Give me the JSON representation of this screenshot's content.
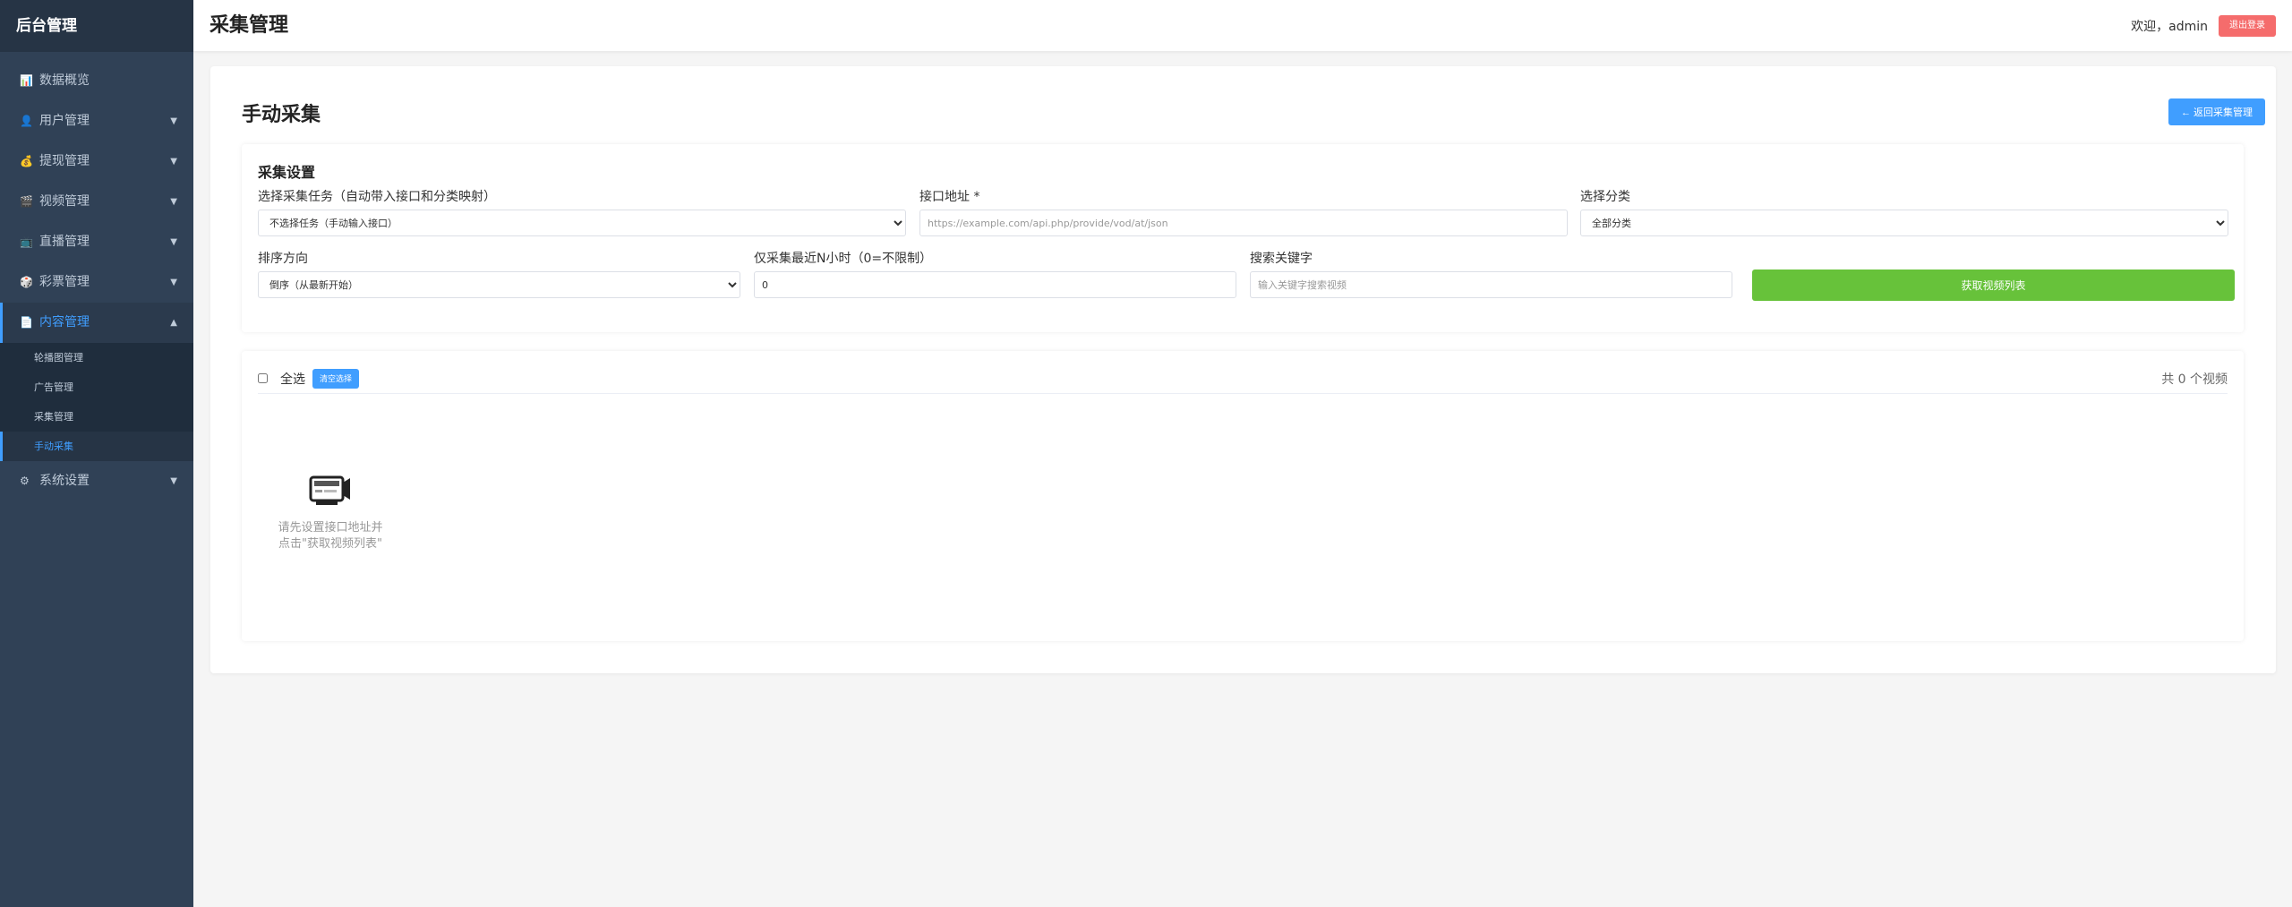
{
  "sidebar": {
    "title": "后台管理",
    "items": [
      {
        "label": "数据概览",
        "icon": "chart-icon",
        "has_arrow": false
      },
      {
        "label": "用户管理",
        "icon": "user-icon",
        "has_arrow": true
      },
      {
        "label": "提现管理",
        "icon": "money-bag-icon",
        "has_arrow": true
      },
      {
        "label": "视频管理",
        "icon": "film-icon",
        "has_arrow": true
      },
      {
        "label": "直播管理",
        "icon": "tv-icon",
        "has_arrow": true
      },
      {
        "label": "彩票管理",
        "icon": "dice-icon",
        "has_arrow": true
      },
      {
        "label": "内容管理",
        "icon": "document-icon",
        "has_arrow": true,
        "open": true
      },
      {
        "label": "系统设置",
        "icon": "gear-icon",
        "has_arrow": true
      }
    ],
    "sub_items": [
      "轮播图管理",
      "广告管理",
      "采集管理",
      "手动采集"
    ],
    "active_sub": "手动采集"
  },
  "header": {
    "title": "采集管理",
    "welcome": "欢迎，admin",
    "logout_label": "退出登录"
  },
  "main": {
    "title": "手动采集",
    "back_label": "← 返回采集管理",
    "settings": {
      "heading": "采集设置",
      "task_label": "选择采集任务（自动带入接口和分类映射）",
      "task_value": "不选择任务（手动输入接口）",
      "api_label": "接口地址 *",
      "api_placeholder": "https://example.com/api.php/provide/vod/at/json",
      "category_label": "选择分类",
      "category_value": "全部分类",
      "sort_label": "排序方向",
      "sort_value": "倒序（从最新开始）",
      "hours_label": "仅采集最近N小时（0=不限制）",
      "hours_value": "0",
      "keyword_label": "搜索关键字",
      "keyword_placeholder": "输入关键字搜索视频",
      "fetch_label": "获取视频列表"
    },
    "list": {
      "select_all_label": "全选",
      "clear_label": "清空选择",
      "total_text": "共 0 个视频",
      "empty_text": "请先设置接口地址并点击\"获取视频列表\""
    }
  },
  "colors": {
    "sidebar_bg": "#304156",
    "accent": "#409eff",
    "success": "#67c23a",
    "danger": "#f56c6c"
  }
}
